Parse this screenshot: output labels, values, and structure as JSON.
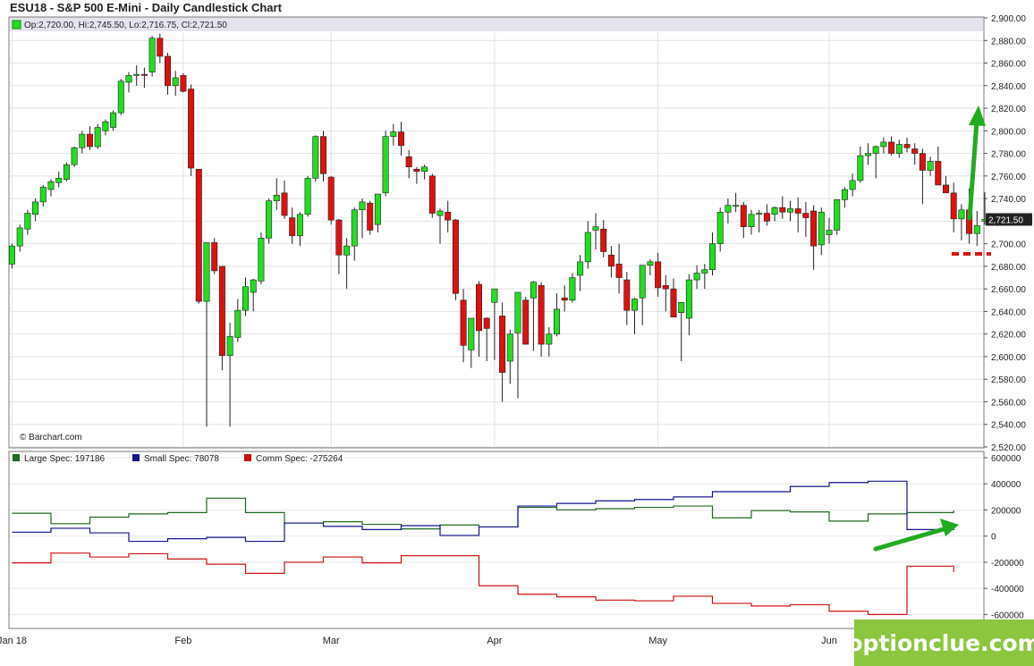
{
  "title": "ESU18 - S&P 500 E-Mini - Daily Candlestick Chart",
  "ohlc_readout": "Op:2,720.00, Hi:2,745.50, Lo:2,716.75, Cl:2,721.50",
  "copyright": "© Barchart.com",
  "watermark": "optionclue.com",
  "colors": {
    "up": "#22dd22",
    "down": "#dd1111",
    "large_spec": "#1f6b1f",
    "small_spec": "#14148c",
    "comm_spec": "#d01010",
    "arrow": "#22aa22",
    "brand_bg": "#8cc63f"
  },
  "chart_data": [
    {
      "type": "candlestick",
      "title": "ESU18 - S&P 500 E-Mini - Daily Candlestick Chart",
      "ylim": [
        2520,
        2900
      ],
      "y_ticks": [
        "2,900.00",
        "2,880.00",
        "2,860.00",
        "2,840.00",
        "2,820.00",
        "2,800.00",
        "2,780.00",
        "2,760.00",
        "2,740.00",
        "2,720.00",
        "2,700.00",
        "2,680.00",
        "2,660.00",
        "2,640.00",
        "2,620.00",
        "2,600.00",
        "2,580.00",
        "2,560.00",
        "2,540.00",
        "2,520.00"
      ],
      "y_tick_values": [
        2900,
        2880,
        2860,
        2840,
        2820,
        2800,
        2780,
        2760,
        2740,
        2720,
        2700,
        2680,
        2660,
        2640,
        2620,
        2600,
        2580,
        2560,
        2540,
        2520
      ],
      "last_price_label": "2,721.50",
      "last_price": 2721.5,
      "x_labels": [
        {
          "label": "Jan 18",
          "index": 0
        },
        {
          "label": "Feb",
          "index": 22
        },
        {
          "label": "Mar",
          "index": 41
        },
        {
          "label": "Apr",
          "index": 62
        },
        {
          "label": "May",
          "index": 83
        },
        {
          "label": "Jun",
          "index": 105
        }
      ],
      "candles": [
        [
          2682,
          2700,
          2678,
          2698
        ],
        [
          2698,
          2717,
          2693,
          2714
        ],
        [
          2713,
          2730,
          2708,
          2727
        ],
        [
          2726,
          2740,
          2720,
          2737
        ],
        [
          2737,
          2752,
          2733,
          2750
        ],
        [
          2748,
          2757,
          2742,
          2755
        ],
        [
          2754,
          2764,
          2750,
          2758
        ],
        [
          2757,
          2772,
          2755,
          2770
        ],
        [
          2770,
          2786,
          2768,
          2785
        ],
        [
          2785,
          2800,
          2780,
          2797
        ],
        [
          2797,
          2804,
          2783,
          2786
        ],
        [
          2786,
          2806,
          2784,
          2803
        ],
        [
          2800,
          2810,
          2796,
          2808
        ],
        [
          2803,
          2818,
          2800,
          2816
        ],
        [
          2816,
          2846,
          2814,
          2844
        ],
        [
          2843,
          2852,
          2834,
          2849
        ],
        [
          2849,
          2858,
          2840,
          2850
        ],
        [
          2850,
          2856,
          2838,
          2849
        ],
        [
          2852,
          2884,
          2848,
          2882
        ],
        [
          2882,
          2886,
          2860,
          2866
        ],
        [
          2866,
          2869,
          2832,
          2840
        ],
        [
          2840,
          2853,
          2831,
          2847
        ],
        [
          2849,
          2851,
          2834,
          2835
        ],
        [
          2837,
          2841,
          2760,
          2767
        ],
        [
          2766,
          2766,
          2647,
          2649
        ],
        [
          2649,
          2680,
          2538,
          2701
        ],
        [
          2701,
          2705,
          2673,
          2676
        ],
        [
          2680,
          2680,
          2588,
          2601
        ],
        [
          2601,
          2630,
          2538,
          2618
        ],
        [
          2617,
          2651,
          2613,
          2641
        ],
        [
          2641,
          2670,
          2636,
          2662
        ],
        [
          2657,
          2669,
          2640,
          2668
        ],
        [
          2667,
          2710,
          2664,
          2705
        ],
        [
          2705,
          2740,
          2700,
          2738
        ],
        [
          2738,
          2758,
          2730,
          2743
        ],
        [
          2745,
          2756,
          2722,
          2725
        ],
        [
          2723,
          2732,
          2700,
          2707
        ],
        [
          2707,
          2728,
          2698,
          2726
        ],
        [
          2726,
          2760,
          2724,
          2758
        ],
        [
          2758,
          2796,
          2755,
          2795
        ],
        [
          2795,
          2800,
          2755,
          2762
        ],
        [
          2759,
          2760,
          2717,
          2721
        ],
        [
          2721,
          2722,
          2673,
          2690
        ],
        [
          2690,
          2705,
          2660,
          2698
        ],
        [
          2698,
          2732,
          2685,
          2730
        ],
        [
          2730,
          2740,
          2705,
          2737
        ],
        [
          2736,
          2738,
          2708,
          2712
        ],
        [
          2717,
          2737,
          2710,
          2744
        ],
        [
          2745,
          2800,
          2742,
          2795
        ],
        [
          2795,
          2806,
          2787,
          2799
        ],
        [
          2799,
          2808,
          2778,
          2787
        ],
        [
          2777,
          2783,
          2758,
          2768
        ],
        [
          2766,
          2768,
          2753,
          2764
        ],
        [
          2764,
          2770,
          2757,
          2768
        ],
        [
          2760,
          2762,
          2723,
          2727
        ],
        [
          2725,
          2731,
          2700,
          2729
        ],
        [
          2728,
          2738,
          2710,
          2721
        ],
        [
          2721,
          2722,
          2650,
          2656
        ],
        [
          2650,
          2660,
          2595,
          2610
        ],
        [
          2606,
          2617,
          2590,
          2634
        ],
        [
          2664,
          2667,
          2600,
          2623
        ],
        [
          2634,
          2635,
          2596,
          2625
        ],
        [
          2648,
          2654,
          2597,
          2660
        ],
        [
          2636,
          2648,
          2560,
          2586
        ],
        [
          2596,
          2624,
          2576,
          2620
        ],
        [
          2621,
          2651,
          2563,
          2657
        ],
        [
          2650,
          2653,
          2626,
          2611
        ],
        [
          2652,
          2667,
          2605,
          2666
        ],
        [
          2663,
          2666,
          2600,
          2611
        ],
        [
          2611,
          2626,
          2600,
          2620
        ],
        [
          2620,
          2656,
          2618,
          2642
        ],
        [
          2652,
          2663,
          2640,
          2650
        ],
        [
          2650,
          2674,
          2648,
          2670
        ],
        [
          2672,
          2690,
          2658,
          2684
        ],
        [
          2684,
          2720,
          2678,
          2710
        ],
        [
          2712,
          2727,
          2695,
          2715
        ],
        [
          2713,
          2721,
          2688,
          2693
        ],
        [
          2690,
          2698,
          2670,
          2680
        ],
        [
          2682,
          2700,
          2656,
          2670
        ],
        [
          2668,
          2675,
          2628,
          2641
        ],
        [
          2641,
          2652,
          2620,
          2651
        ],
        [
          2652,
          2661,
          2628,
          2681
        ],
        [
          2681,
          2686,
          2672,
          2684
        ],
        [
          2684,
          2692,
          2653,
          2661
        ],
        [
          2663,
          2672,
          2640,
          2660
        ],
        [
          2660,
          2669,
          2637,
          2635
        ],
        [
          2639,
          2643,
          2596,
          2648
        ],
        [
          2634,
          2673,
          2619,
          2668
        ],
        [
          2668,
          2681,
          2660,
          2674
        ],
        [
          2674,
          2682,
          2660,
          2677
        ],
        [
          2677,
          2710,
          2672,
          2700
        ],
        [
          2700,
          2732,
          2693,
          2728
        ],
        [
          2728,
          2740,
          2718,
          2734
        ],
        [
          2733,
          2745,
          2728,
          2734
        ],
        [
          2734,
          2737,
          2705,
          2715
        ],
        [
          2715,
          2730,
          2708,
          2726
        ],
        [
          2726,
          2730,
          2710,
          2727
        ],
        [
          2727,
          2735,
          2716,
          2720
        ],
        [
          2726,
          2733,
          2720,
          2732
        ],
        [
          2732,
          2742,
          2722,
          2728
        ],
        [
          2728,
          2738,
          2720,
          2731
        ],
        [
          2731,
          2741,
          2710,
          2727
        ],
        [
          2727,
          2737,
          2706,
          2723
        ],
        [
          2729,
          2734,
          2677,
          2698
        ],
        [
          2699,
          2732,
          2690,
          2728
        ],
        [
          2708,
          2723,
          2700,
          2712
        ],
        [
          2712,
          2738,
          2708,
          2739
        ],
        [
          2739,
          2750,
          2732,
          2748
        ],
        [
          2748,
          2762,
          2742,
          2756
        ],
        [
          2756,
          2786,
          2754,
          2778
        ],
        [
          2778,
          2789,
          2770,
          2780
        ],
        [
          2780,
          2787,
          2758,
          2786
        ],
        [
          2786,
          2794,
          2780,
          2790
        ],
        [
          2790,
          2795,
          2778,
          2780
        ],
        [
          2780,
          2792,
          2776,
          2788
        ],
        [
          2788,
          2794,
          2781,
          2785
        ],
        [
          2784,
          2789,
          2770,
          2780
        ],
        [
          2780,
          2784,
          2735,
          2765
        ],
        [
          2765,
          2777,
          2760,
          2773
        ],
        [
          2773,
          2786,
          2755,
          2752
        ],
        [
          2752,
          2760,
          2748,
          2745
        ],
        [
          2745,
          2754,
          2710,
          2722
        ],
        [
          2722,
          2735,
          2703,
          2730
        ],
        [
          2730,
          2749,
          2700,
          2709
        ],
        [
          2709,
          2729,
          2698,
          2716
        ],
        [
          2720,
          2745.5,
          2716.75,
          2721.5
        ]
      ]
    },
    {
      "type": "line",
      "title": "",
      "ylim": [
        -700000,
        600000
      ],
      "y_ticks": [
        "600000",
        "400000",
        "200000",
        "0",
        "-200000",
        "-400000",
        "-600000"
      ],
      "y_tick_values": [
        600000,
        400000,
        200000,
        0,
        -200000,
        -400000,
        -600000
      ],
      "series": [
        {
          "name": "Large Spec",
          "legend": "Large Spec: 197186",
          "color_key": "large_spec",
          "x": [
            0,
            5,
            10,
            15,
            20,
            25,
            30,
            35,
            40,
            45,
            50,
            55,
            60,
            65,
            70,
            75,
            80,
            85,
            90,
            95,
            100,
            105,
            110,
            115,
            121
          ],
          "values": [
            175000,
            95000,
            145000,
            170000,
            180000,
            290000,
            180000,
            100000,
            110000,
            90000,
            55000,
            85000,
            70000,
            220000,
            200000,
            210000,
            220000,
            230000,
            140000,
            195000,
            185000,
            115000,
            170000,
            180000,
            197186
          ]
        },
        {
          "name": "Small Spec",
          "legend": "Small Spec: 78078",
          "color_key": "small_spec",
          "x": [
            0,
            5,
            10,
            15,
            20,
            25,
            30,
            35,
            40,
            45,
            50,
            55,
            60,
            65,
            70,
            75,
            80,
            85,
            90,
            95,
            100,
            105,
            110,
            115,
            121
          ],
          "values": [
            30000,
            60000,
            25000,
            -40000,
            -20000,
            -10000,
            -40000,
            100000,
            75000,
            50000,
            80000,
            5000,
            70000,
            230000,
            250000,
            270000,
            280000,
            300000,
            340000,
            340000,
            380000,
            410000,
            420000,
            50000,
            78078
          ]
        },
        {
          "name": "Comm Spec",
          "legend": "Comm Spec: -275264",
          "color_key": "comm_spec",
          "x": [
            0,
            5,
            10,
            15,
            20,
            25,
            30,
            35,
            40,
            45,
            50,
            55,
            60,
            65,
            70,
            75,
            80,
            85,
            90,
            95,
            100,
            105,
            110,
            115,
            121
          ],
          "values": [
            -205000,
            -130000,
            -160000,
            -135000,
            -175000,
            -215000,
            -285000,
            -200000,
            -160000,
            -205000,
            -150000,
            -150000,
            -380000,
            -445000,
            -465000,
            -490000,
            -495000,
            -460000,
            -515000,
            -535000,
            -525000,
            -575000,
            -600000,
            -230000,
            -275264
          ]
        }
      ]
    }
  ]
}
